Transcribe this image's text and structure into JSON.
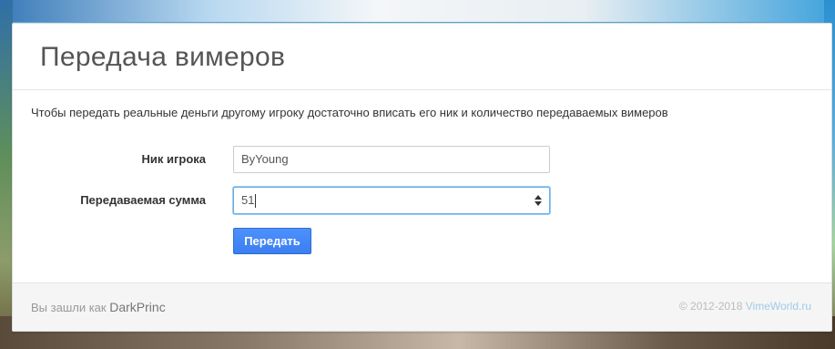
{
  "page": {
    "title": "Передача вимеров",
    "description": "Чтобы передать реальные деньги другому игроку достаточно вписать его ник и количество передаваемых вимеров"
  },
  "form": {
    "nick_label": "Ник игрока",
    "nick_value": "ByYoung",
    "amount_label": "Передаваемая сумма",
    "amount_value": "51",
    "submit_label": "Передать"
  },
  "footer": {
    "logged_in_prefix": "Вы зашли как",
    "username": "DarkPrinc",
    "copyright": "© 2012-2018",
    "site_link": "VimeWorld.ru"
  },
  "colors": {
    "accent": "#4d90fe",
    "focus_border": "#66afe9",
    "link": "#9ecbe8"
  },
  "icons": {
    "amount_spinner": "up-down-arrows-icon"
  }
}
